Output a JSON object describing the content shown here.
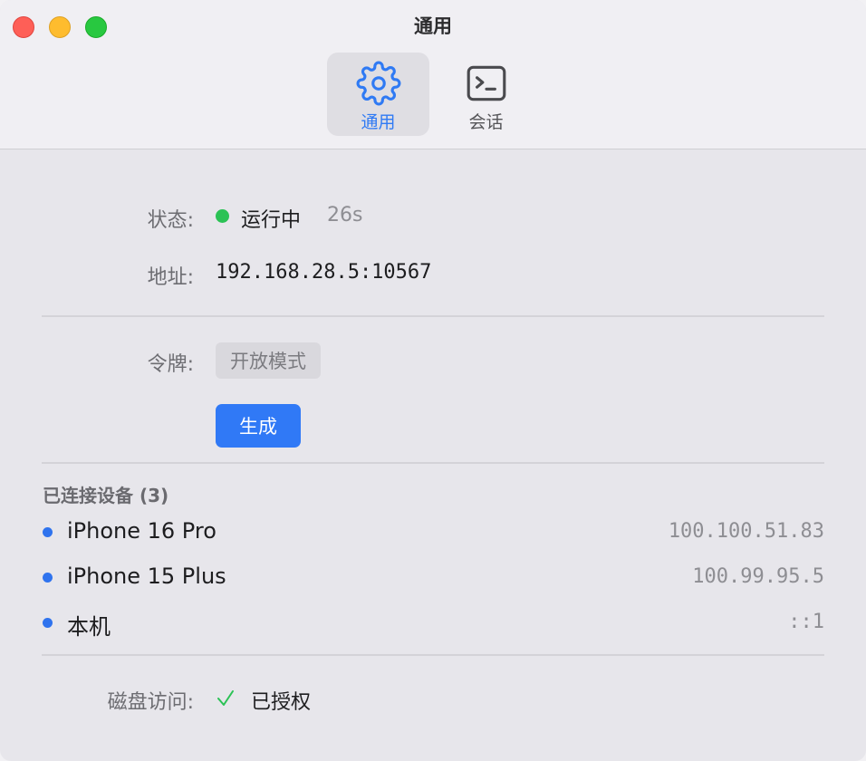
{
  "window": {
    "title": "通用",
    "traffic_lights": {
      "close": "#fe5f57",
      "minimize": "#febc2e",
      "maximize": "#28c840"
    }
  },
  "toolbar": {
    "tabs": [
      {
        "label": "通用",
        "icon": "gear-icon",
        "active": true
      },
      {
        "label": "会话",
        "icon": "terminal-icon",
        "active": false
      }
    ]
  },
  "status": {
    "label": "状态:",
    "value": "运行中",
    "uptime": "26s",
    "indicator_color": "#2bc255"
  },
  "address": {
    "label": "地址:",
    "value": "192.168.28.5:10567"
  },
  "token": {
    "label": "令牌:",
    "value": "开放模式",
    "generate_label": "生成"
  },
  "devices": {
    "title": "已连接设备 (3)",
    "items": [
      {
        "name": "iPhone 16 Pro",
        "ip": "100.100.51.83"
      },
      {
        "name": "iPhone 15 Plus",
        "ip": "100.99.95.5"
      },
      {
        "name": "本机",
        "ip": "::1"
      }
    ]
  },
  "disk_access": {
    "label": "磁盘访问:",
    "value": "已授权",
    "icon": "checkmark-icon"
  },
  "colors": {
    "accent": "#3079f6",
    "device_dot": "#2f73ee",
    "check": "#2bc255"
  }
}
